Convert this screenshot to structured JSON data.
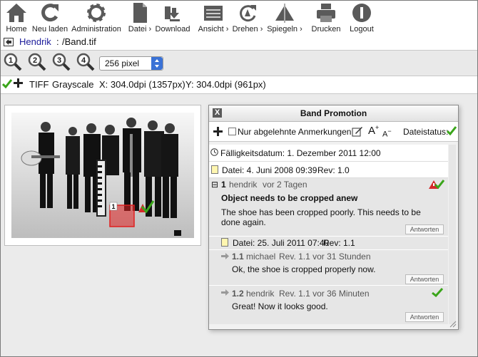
{
  "toolbar": {
    "items": [
      {
        "label": "Home",
        "icon": "home-icon"
      },
      {
        "label": "Neu laden",
        "icon": "reload-icon"
      },
      {
        "label": "Administration",
        "icon": "gear-icon"
      },
      {
        "label": "Datei ›",
        "icon": "file-icon"
      },
      {
        "label": "Download",
        "icon": "download-icon"
      },
      {
        "label": "Ansicht ›",
        "icon": "view-icon"
      },
      {
        "label": "Drehen ›",
        "icon": "rotate-icon"
      },
      {
        "label": "Spiegeln ›",
        "icon": "mirror-icon"
      },
      {
        "label": "Drucken",
        "icon": "printer-icon"
      },
      {
        "label": "Logout",
        "icon": "logout-icon"
      }
    ]
  },
  "path": {
    "user": "Hendrik",
    "separator": ":",
    "file": "/Band.tif"
  },
  "zoom": {
    "levels": [
      "1",
      "2",
      "3",
      "4"
    ],
    "size_select": "256 pixel"
  },
  "info": {
    "format": "TIFF",
    "mode": "Grayscale",
    "x": "X: 304.0dpi (1357px)",
    "y": "Y: 304.0dpi (961px)"
  },
  "image": {
    "marker_number": "1",
    "marker_color": "#e02020"
  },
  "dialog": {
    "title": "Band Promotion",
    "close": "X",
    "filter_label": "Nur abgelehnte Anmerkungen",
    "status_label": "Dateistatus:",
    "due": "Fälligkeitsdatum: 1. Dezember 2011 12:00",
    "file1": {
      "date": "Datei: 4. Juni 2008 09:39",
      "rev": "Rev: 1.0"
    },
    "comment1": {
      "collapse": "⊟",
      "number": "1",
      "author": "hendrik",
      "time": "vor 2 Tagen",
      "title": "Object needs to be cropped anew",
      "text": "The shoe has been cropped poorly. This needs to be done again.",
      "reply": "Antworten"
    },
    "file2": {
      "date": "Datei: 25. Juli 2011 07:40",
      "rev": "Rev: 1.1"
    },
    "reply11": {
      "number": "1.1",
      "author": "michael",
      "rev": "Rev. 1.1 vor 31 Stunden",
      "text": "Ok, the shoe is cropped properly now.",
      "reply": "Antworten"
    },
    "reply12": {
      "number": "1.2",
      "author": "hendrik",
      "rev": "Rev. 1.1 vor 36 Minuten",
      "text": "Great! Now it looks good.",
      "reply": "Antworten"
    }
  },
  "colors": {
    "link": "#1a1a9a",
    "accent_blue": "#3a72d6",
    "approved_green": "#3aa51a",
    "warning_red": "#d42a2a"
  }
}
